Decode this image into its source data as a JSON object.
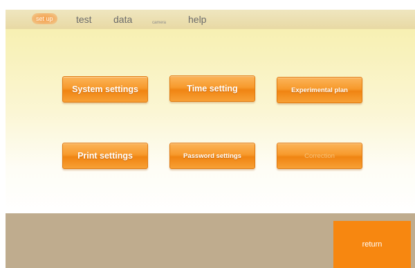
{
  "menu": {
    "setup": "set up",
    "test": "test",
    "data": "data",
    "camera": "camera",
    "help": "help"
  },
  "buttons": {
    "system_settings": "System settings",
    "time_setting": "Time setting",
    "experimental_plan": "Experimental plan",
    "print_settings": "Print settings",
    "password_settings": "Password settings",
    "correction": "Correction"
  },
  "footer": {
    "return": "return"
  },
  "colors": {
    "accent_orange": "#f79a2c",
    "bottom_bar": "#bfac8e",
    "return_button": "#f78710"
  }
}
